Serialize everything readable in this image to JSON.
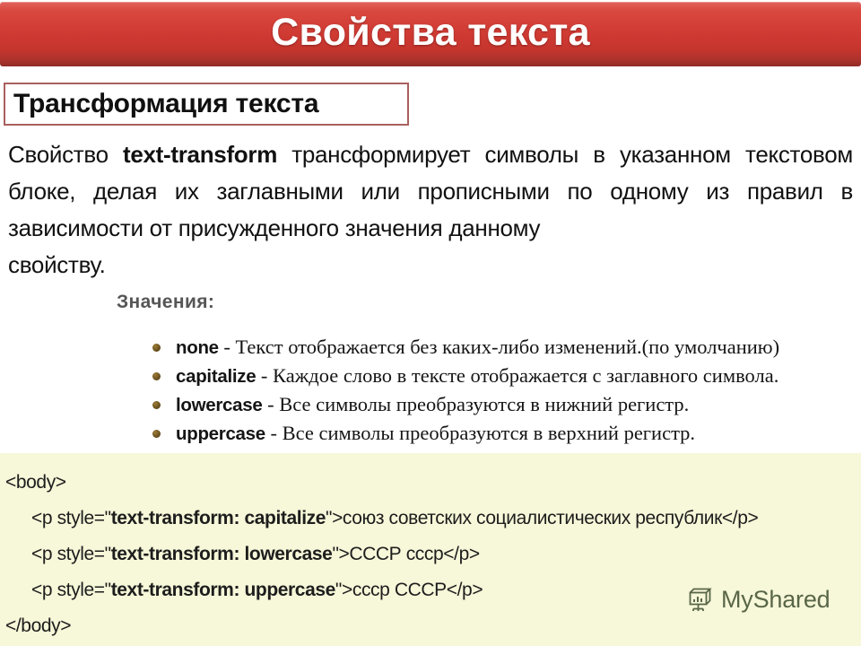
{
  "header": {
    "title": "Свойства текста",
    "accent_color": "#cf3a33"
  },
  "subtitle": {
    "text": "Трансформация текста",
    "border_color": "#a9605d"
  },
  "intro": {
    "part1": "Свойство ",
    "property_name": "text-transform",
    "part2": " трансформирует символы в указанном текстовом блоке, делая их заглавными или прописными по одному из правил в зависимости от присужденного значения данному",
    "part3": "свойству."
  },
  "values_section": {
    "label": "Значения:",
    "label_color": "#565656",
    "items": [
      {
        "name": "none",
        "description": " - Текст отображается без каких-либо изменений.(по умолчанию)"
      },
      {
        "name": "capitalize",
        "description": " - Каждое слово в тексте отображается с заглавного символа."
      },
      {
        "name": "lowercase",
        "description": " - Все символы преобразуются в нижний регистр."
      },
      {
        "name": "uppercase",
        "description": " - Все символы преобразуются в верхний регистр."
      }
    ]
  },
  "code_block": {
    "background_color": "#f7f7d9",
    "lines": [
      {
        "open": "<body>",
        "bold": "",
        "close": ""
      },
      {
        "open": "<p style=\"",
        "bold": "text-transform: capitalize",
        "close": "\">союз советских социалистических республик</p>"
      },
      {
        "open": "<p style=\"",
        "bold": "text-transform: lowercase",
        "close": "\">СССР сссp</p>"
      },
      {
        "open": "<p style=\"",
        "bold": "text-transform: uppercase",
        "close": "\">сссp СССР</p>"
      },
      {
        "open": "</body>",
        "bold": "",
        "close": ""
      }
    ]
  },
  "watermark": {
    "label": "MyShared",
    "icon": "presentation-board-icon",
    "color": "#4c5a3c"
  }
}
